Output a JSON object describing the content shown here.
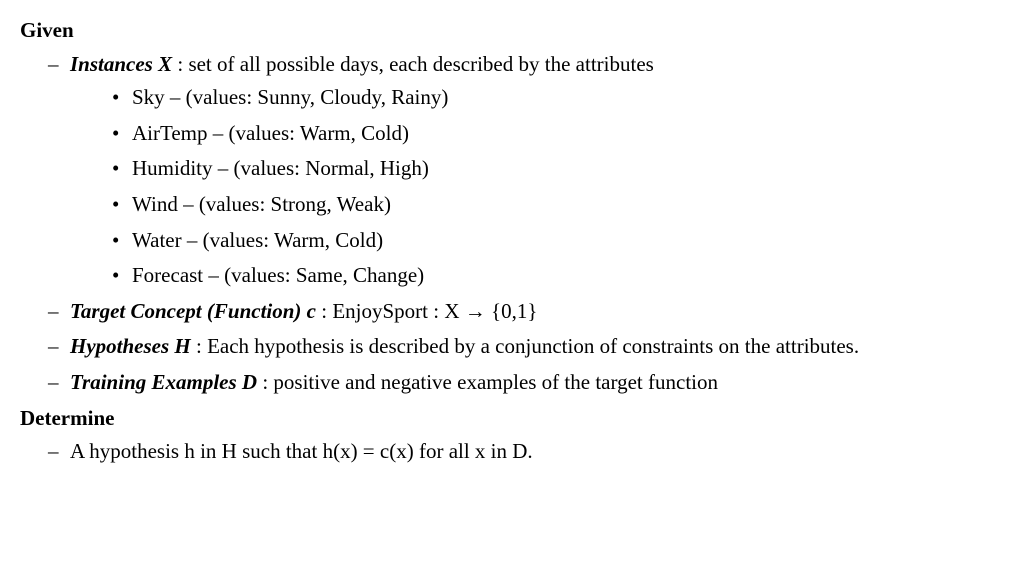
{
  "given": {
    "heading": "Given",
    "instances": {
      "label": "Instances X",
      "description": " : set of all possible days, each described by the attributes",
      "attributes": [
        "Sky – (values: Sunny, Cloudy, Rainy)",
        "AirTemp – (values: Warm, Cold)",
        "Humidity – (values: Normal, High)",
        "Wind – (values: Strong, Weak)",
        "Water – (values: Warm, Cold)",
        "Forecast – (values: Same, Change)"
      ]
    },
    "target_concept": {
      "label": "Target Concept (Function) c",
      "description": " :   EnjoySport :   X  →  {0,1}"
    },
    "hypotheses": {
      "label": "Hypotheses H",
      "description": " : Each hypothesis is described by a conjunction of constraints on the attributes."
    },
    "training_examples": {
      "label": "Training Examples D",
      "description": " : positive and negative examples of the target function"
    }
  },
  "determine": {
    "heading": "Determine",
    "item": "A hypothesis h in H such that h(x) = c(x) for all x in D."
  }
}
